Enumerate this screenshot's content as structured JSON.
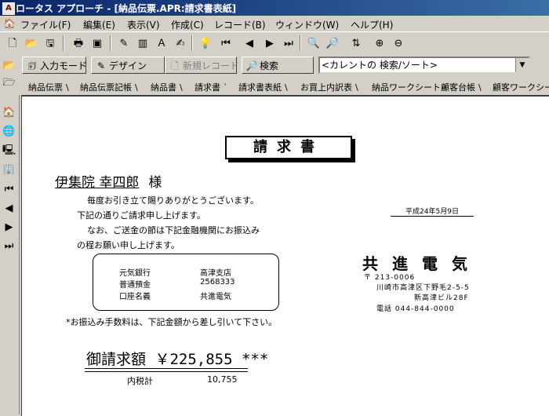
{
  "window": {
    "title": "ロータス アプローチ - [納品伝票.APR:請求書表紙]"
  },
  "menu": [
    "ファイル(F)",
    "編集(E)",
    "表示(V)",
    "作成(C)",
    "レコード(B)",
    "ウィンドウ(W)",
    "ヘルプ(H)"
  ],
  "modebar": {
    "browse": "入力モード",
    "design": "デザイン",
    "new_record": "新規レコード",
    "find": "検索",
    "query": "<カレントの 検索/ソート>"
  },
  "tabs": [
    "納品伝票",
    "納品伝票記帳",
    "納品書",
    "請求書",
    "請求書表紙",
    "お買上内訳表",
    "納品ワークシート",
    "顧客台帳",
    "顧客ワークシート"
  ],
  "document": {
    "title": "請求書",
    "customer_name": "伊集院 幸四郎",
    "honorific": "様",
    "greeting": [
      "毎度お引き立て賜りありがとうございます。",
      "下記の通りご請求申し上げます。",
      "なお、ご送金の節は下記金融機関にお振込み",
      "の程お願い申し上げます。"
    ],
    "date": "平成24年5月9日",
    "bank": [
      {
        "label": "元気銀行",
        "value": "高津支店"
      },
      {
        "label": "普通預金",
        "value": "2568333"
      },
      {
        "label": "口座名義",
        "value": "共進電気"
      }
    ],
    "company": "共進電気",
    "postal": "〒 213-0006",
    "address1": "川崎市高津区下野毛2-5-5",
    "address2": "新高津ビル28F",
    "phone": "電話 044-844-0000",
    "fee_note": "*お振込み手数料は、下記金額から差し引いて下さい。",
    "total": "御請求額 ￥225,855 ***",
    "tax_label": "内税計",
    "tax_value": "10,755"
  }
}
